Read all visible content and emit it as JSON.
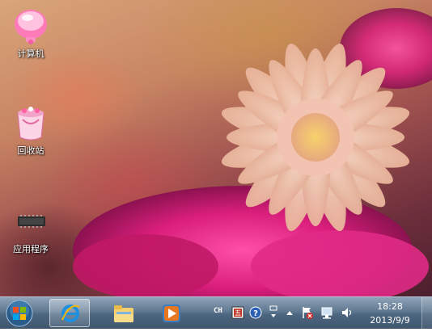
{
  "desktop": {
    "icons": [
      {
        "name": "computer",
        "label": "计算机"
      },
      {
        "name": "recycle-bin",
        "label": "回收站"
      },
      {
        "name": "applications",
        "label": "应用程序"
      }
    ]
  },
  "taskbar": {
    "start_icon": "windows-start-orb",
    "pinned": [
      {
        "name": "internet-explorer",
        "icon": "ie-icon",
        "active": true
      },
      {
        "name": "file-explorer",
        "icon": "folder-icon",
        "active": false
      },
      {
        "name": "media-player",
        "icon": "media-player-icon",
        "active": false
      }
    ],
    "tray": {
      "language": "CH",
      "icons": [
        "ime-icon",
        "help-icon",
        "ime-options-icon",
        "show-hidden-icons-arrow",
        "action-center-flag-icon",
        "network-icon",
        "volume-icon"
      ]
    },
    "clock": {
      "time": "18:28",
      "date": "2013/9/9"
    }
  },
  "colors": {
    "taskbar": "#4c6680",
    "label_text": "#ffffff"
  }
}
